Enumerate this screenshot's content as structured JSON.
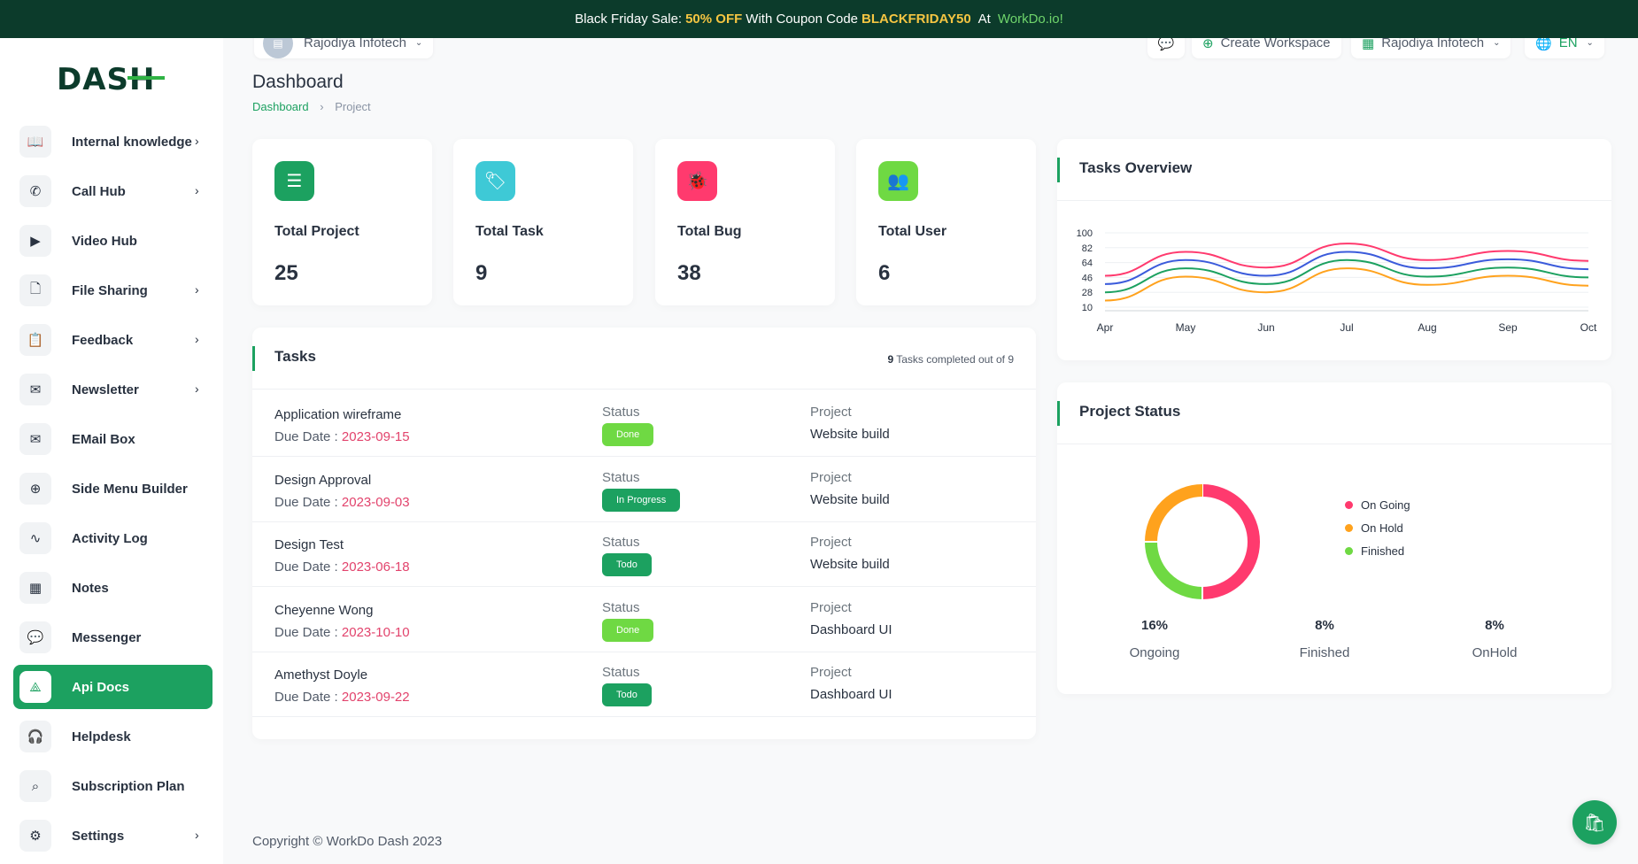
{
  "promo": {
    "prefix": "Black Friday Sale:",
    "discount": "50% OFF",
    "middle": "With Coupon Code",
    "code": "BLACKFRIDAY50",
    "at": "At",
    "site": "WorkDo.io!"
  },
  "logo": {
    "text_a": "DAS",
    "text_b": "H"
  },
  "sidebar": {
    "items": [
      {
        "label": "Internal knowledge",
        "icon": "book-icon",
        "glyph": "📖",
        "chevron": true,
        "active": false
      },
      {
        "label": "Call Hub",
        "icon": "phone-icon",
        "glyph": "✆",
        "chevron": true,
        "active": false
      },
      {
        "label": "Video Hub",
        "icon": "video-icon",
        "glyph": "▶",
        "chevron": false,
        "active": false
      },
      {
        "label": "File Sharing",
        "icon": "file-icon",
        "glyph": "🗋",
        "chevron": true,
        "active": false
      },
      {
        "label": "Feedback",
        "icon": "clipboard-icon",
        "glyph": "📋",
        "chevron": true,
        "active": false
      },
      {
        "label": "Newsletter",
        "icon": "envelope-icon",
        "glyph": "✉",
        "chevron": true,
        "active": false
      },
      {
        "label": "EMail Box",
        "icon": "mail-icon",
        "glyph": "✉",
        "chevron": false,
        "active": false
      },
      {
        "label": "Side Menu Builder",
        "icon": "plus-circle-icon",
        "glyph": "⊕",
        "chevron": false,
        "active": false
      },
      {
        "label": "Activity Log",
        "icon": "pulse-icon",
        "glyph": "∿",
        "chevron": false,
        "active": false
      },
      {
        "label": "Notes",
        "icon": "calendar-icon",
        "glyph": "▦",
        "chevron": false,
        "active": false
      },
      {
        "label": "Messenger",
        "icon": "chat-icon",
        "glyph": "💬",
        "chevron": false,
        "active": false
      },
      {
        "label": "Api Docs",
        "icon": "api-icon",
        "glyph": "⟁",
        "chevron": false,
        "active": true
      },
      {
        "label": "Helpdesk",
        "icon": "headset-icon",
        "glyph": "🎧",
        "chevron": false,
        "active": false
      },
      {
        "label": "Subscription Plan",
        "icon": "search-plan-icon",
        "glyph": "⌕",
        "chevron": false,
        "active": false
      },
      {
        "label": "Settings",
        "icon": "gear-icon",
        "glyph": "⚙",
        "chevron": true,
        "active": false
      }
    ],
    "chevron_glyph": "›"
  },
  "topbar": {
    "workspace": "Rajodiya Infotech",
    "create_workspace": "Create Workspace",
    "user": "Rajodiya Infotech",
    "language": "EN"
  },
  "page": {
    "title": "Dashboard",
    "breadcrumb_home": "Dashboard",
    "breadcrumb_current": "Project",
    "breadcrumb_sep": "›"
  },
  "stats": [
    {
      "title": "Total Project",
      "value": "25",
      "color": "#1ca160",
      "icon": "list-check-icon",
      "glyph": "☰"
    },
    {
      "title": "Total Task",
      "value": "9",
      "color": "#3ec9d6",
      "icon": "tag-icon",
      "glyph": "🏷"
    },
    {
      "title": "Total Bug",
      "value": "38",
      "color": "#ff3a6e",
      "icon": "bug-icon",
      "glyph": "🐞"
    },
    {
      "title": "Total User",
      "value": "6",
      "color": "#6fd943",
      "icon": "users-icon",
      "glyph": "👥"
    }
  ],
  "tasks": {
    "title": "Tasks",
    "completed_count": "9",
    "completed_text": "Tasks completed out of 9",
    "status_label": "Status",
    "project_label": "Project",
    "due_label": "Due Date :",
    "rows": [
      {
        "name": "Application wireframe",
        "due": "2023-09-15",
        "status": "Done",
        "status_color": "#6fd943",
        "project": "Website build"
      },
      {
        "name": "Design Approval",
        "due": "2023-09-03",
        "status": "In Progress",
        "status_color": "#1ca160",
        "project": "Website build"
      },
      {
        "name": "Design Test",
        "due": "2023-06-18",
        "status": "Todo",
        "status_color": "#1ca160",
        "project": "Website build"
      },
      {
        "name": "Cheyenne Wong",
        "due": "2023-10-10",
        "status": "Done",
        "status_color": "#6fd943",
        "project": "Dashboard UI"
      },
      {
        "name": "Amethyst Doyle",
        "due": "2023-09-22",
        "status": "Todo",
        "status_color": "#1ca160",
        "project": "Dashboard UI"
      }
    ]
  },
  "tasks_overview": {
    "title": "Tasks Overview"
  },
  "chart_data": [
    {
      "type": "line",
      "title": "Tasks Overview",
      "categories": [
        "Apr",
        "May",
        "Jun",
        "Jul",
        "Aug",
        "Sep",
        "Oct"
      ],
      "y_ticks": [
        10,
        28,
        46,
        64,
        82,
        100
      ],
      "ylim": [
        10,
        100
      ],
      "grid": true,
      "series": [
        {
          "color": "#ff3a6e",
          "values": [
            48,
            77,
            58,
            87,
            67,
            78,
            66
          ]
        },
        {
          "color": "#3b5bdb",
          "values": [
            38,
            67,
            48,
            77,
            57,
            68,
            56
          ]
        },
        {
          "color": "#1ca160",
          "values": [
            28,
            57,
            38,
            67,
            47,
            58,
            46
          ]
        },
        {
          "color": "#ffa21d",
          "values": [
            18,
            47,
            28,
            57,
            37,
            48,
            36
          ]
        }
      ]
    },
    {
      "type": "pie",
      "title": "Project Status",
      "legend": [
        "On Going",
        "On Hold",
        "Finished"
      ],
      "legend_colors": [
        "#ff3a6e",
        "#ffa21d",
        "#6fd943"
      ],
      "values": [
        16,
        8,
        8
      ],
      "labels": [
        "Ongoing",
        "Finished",
        "OnHold"
      ],
      "display": [
        "16%",
        "8%",
        "8%"
      ]
    }
  ],
  "project_status": {
    "title": "Project Status",
    "legend": [
      {
        "label": "On Going",
        "color": "#ff3a6e"
      },
      {
        "label": "On Hold",
        "color": "#ffa21d"
      },
      {
        "label": "Finished",
        "color": "#6fd943"
      }
    ],
    "stats": [
      {
        "value": "16%",
        "label": "Ongoing"
      },
      {
        "value": "8%",
        "label": "Finished"
      },
      {
        "value": "8%",
        "label": "OnHold"
      }
    ]
  },
  "footer": {
    "text": "Copyright © WorkDo Dash 2023"
  },
  "fab": {
    "icon": "shopping-bag-icon",
    "glyph": "🛍"
  }
}
